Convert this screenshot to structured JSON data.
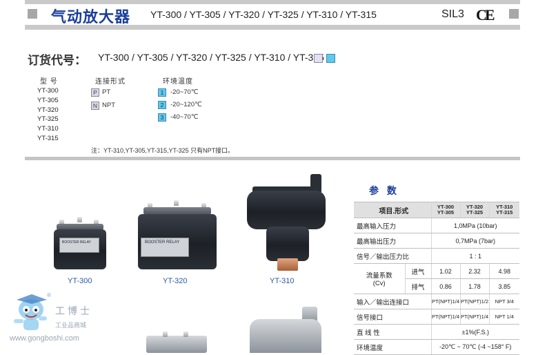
{
  "header": {
    "title": "气动放大器",
    "models": "YT-300 / YT-305 / YT-320 / YT-325 / YT-310 / YT-315",
    "sil": "SIL3",
    "ce": "CE"
  },
  "order": {
    "label": "订货代号：",
    "models": "YT-300 / YT-305 / YT-320 / YT-325 / YT-310 / YT-315",
    "colors": {
      "connection_box": "#e4e0f0",
      "temperature_box": "#5fc9ea"
    },
    "columns": {
      "model": "型 号",
      "connection": "连接形式",
      "temperature": "环境温度"
    },
    "model_list": [
      "YT-300",
      "YT-305",
      "YT-320",
      "YT-325",
      "YT-310",
      "YT-315"
    ],
    "connections": [
      {
        "code": "P",
        "label": "PT"
      },
      {
        "code": "N",
        "label": "NPT"
      }
    ],
    "temperatures": [
      {
        "code": "1",
        "label": "-20~70℃"
      },
      {
        "code": "2",
        "label": "-20~120℃"
      },
      {
        "code": "3",
        "label": "-40~70℃"
      }
    ],
    "note": "注：YT-310,YT-305,YT-315,YT-325 只有NPT接口。"
  },
  "products": [
    {
      "label": "YT-300",
      "plate": "BOOSTER RELAY"
    },
    {
      "label": "YT-320",
      "plate": "BOOSTER RELAY"
    },
    {
      "label": "YT-310"
    }
  ],
  "watermark": {
    "reg": "®",
    "cn": "工博士",
    "sub": "工业品商城",
    "url": "www.gongboshi.com"
  },
  "spec": {
    "title": "参 数",
    "head": {
      "label": "项目.形式",
      "c1a": "YT-300",
      "c1b": "YT-305",
      "c2a": "YT-320",
      "c2b": "YT-325",
      "c3a": "YT-310",
      "c3b": "YT-315"
    },
    "rows": {
      "max_in": {
        "label": "最高输入压力",
        "value": "1,0MPa (10bar)"
      },
      "max_out": {
        "label": "最高输出压力",
        "value": "0,7MPa (7bar)"
      },
      "ratio": {
        "label": "信号／输出压力比",
        "value": "1 : 1"
      },
      "flow": {
        "label": "流量系数",
        "label2": "(Cv)",
        "in_label": "进气",
        "in_values": [
          "1.02",
          "2.32",
          "4.98"
        ],
        "out_label": "排气",
        "out_values": [
          "0.86",
          "1.78",
          "3.85"
        ]
      },
      "io_port": {
        "label": "输入／输出连接口",
        "values": [
          "PT(NPT)1/4",
          "PT(NPT)1/2",
          "NPT 3/4"
        ]
      },
      "sig_port": {
        "label": "信号接口",
        "values": [
          "PT(NPT)1/4",
          "PT(NPT)1/4",
          "NPT 1/4"
        ]
      },
      "linearity": {
        "label": "直 线 性",
        "value": "±1%(F.S.)"
      },
      "env_temp": {
        "label": "环境温度",
        "value": "-20℃ ~ 70℃ (-4 ~158° F)"
      }
    }
  }
}
